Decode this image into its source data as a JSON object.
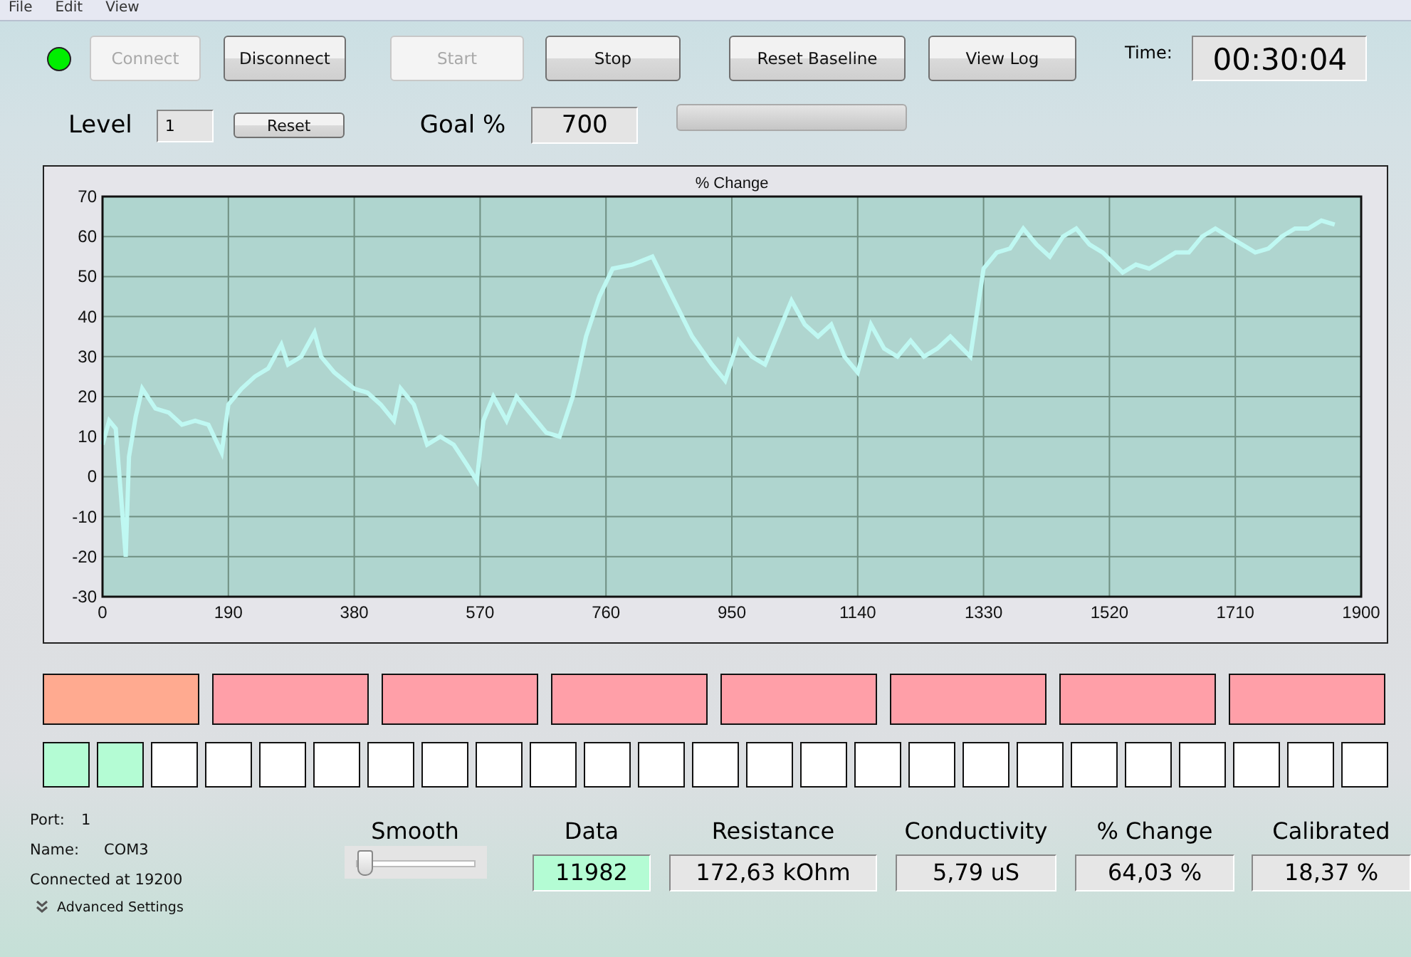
{
  "menu": [
    "File",
    "Edit",
    "View"
  ],
  "toolbar": {
    "connected": true,
    "buttons": [
      {
        "label": "Connect",
        "disabled": true
      },
      {
        "label": "Disconnect",
        "disabled": false
      },
      {
        "label": "Start",
        "disabled": true
      },
      {
        "label": "Stop",
        "disabled": false
      },
      {
        "label": "Reset Baseline",
        "disabled": false
      },
      {
        "label": "View Log",
        "disabled": false
      }
    ],
    "time_label": "Time:",
    "time": "00:30:04"
  },
  "level_row": {
    "level_label": "Level",
    "level_value": "1",
    "reset_button": "Reset",
    "goal_label": "Goal %",
    "goal_value": "700",
    "progress": {
      "level": 0
    }
  },
  "chart": {
    "chart_data": {
      "type": "line",
      "title": "% Change",
      "grid": true,
      "xlim": [
        0,
        1900
      ],
      "ylim": [
        -30,
        70
      ],
      "xticks": [
        0,
        190,
        380,
        570,
        760,
        950,
        1140,
        1330,
        1520,
        1710,
        1900
      ],
      "yticks": [
        -30,
        -20,
        -10,
        0,
        10,
        20,
        30,
        40,
        50,
        60,
        70
      ],
      "x": [
        0,
        10,
        20,
        35,
        40,
        50,
        60,
        80,
        100,
        120,
        140,
        160,
        180,
        190,
        210,
        230,
        250,
        270,
        280,
        300,
        320,
        330,
        350,
        380,
        400,
        420,
        440,
        450,
        470,
        490,
        510,
        530,
        550,
        565,
        575,
        590,
        610,
        625,
        650,
        670,
        690,
        710,
        730,
        750,
        770,
        800,
        830,
        860,
        890,
        920,
        940,
        960,
        980,
        1000,
        1020,
        1040,
        1060,
        1080,
        1100,
        1120,
        1140,
        1160,
        1180,
        1200,
        1220,
        1240,
        1260,
        1280,
        1310,
        1330,
        1350,
        1370,
        1390,
        1410,
        1430,
        1450,
        1470,
        1490,
        1510,
        1540,
        1560,
        1580,
        1600,
        1620,
        1640,
        1660,
        1680,
        1700,
        1720,
        1740,
        1760,
        1780,
        1800,
        1820,
        1840,
        1860
      ],
      "series": [
        {
          "color": "#bff8f2",
          "values": [
            8,
            14,
            12,
            -20,
            5,
            15,
            22,
            17,
            16,
            13,
            14,
            13,
            6,
            18,
            22,
            25,
            27,
            33,
            28,
            30,
            36,
            30,
            26,
            22,
            21,
            18,
            14,
            22,
            18,
            8,
            10,
            8,
            3,
            -1,
            14,
            20,
            14,
            20,
            15,
            11,
            10,
            20,
            35,
            45,
            52,
            53,
            55,
            45,
            35,
            28,
            24,
            34,
            30,
            28,
            36,
            44,
            38,
            35,
            38,
            30,
            26,
            38,
            32,
            30,
            34,
            30,
            32,
            35,
            30,
            52,
            56,
            57,
            62,
            58,
            55,
            60,
            62,
            58,
            56,
            51,
            53,
            52,
            54,
            56,
            56,
            60,
            62,
            60,
            58,
            56,
            57,
            60,
            62,
            62,
            64,
            63
          ]
        }
      ]
    }
  },
  "bars": [
    {
      "color": "#ffaa90"
    },
    {
      "color": "#ff9fa8"
    },
    {
      "color": "#ff9fa8"
    },
    {
      "color": "#ff9fa8"
    },
    {
      "color": "#ff9fa8"
    },
    {
      "color": "#ff9fa8"
    },
    {
      "color": "#ff9fa8"
    },
    {
      "color": "#ff9fa8"
    }
  ],
  "squares": [
    {
      "color": "#b4fcd4"
    },
    {
      "color": "#b4fcd4"
    },
    {
      "color": "#ffffff"
    },
    {
      "color": "#ffffff"
    },
    {
      "color": "#ffffff"
    },
    {
      "color": "#ffffff"
    },
    {
      "color": "#ffffff"
    },
    {
      "color": "#ffffff"
    },
    {
      "color": "#ffffff"
    },
    {
      "color": "#ffffff"
    },
    {
      "color": "#ffffff"
    },
    {
      "color": "#ffffff"
    },
    {
      "color": "#ffffff"
    },
    {
      "color": "#ffffff"
    },
    {
      "color": "#ffffff"
    },
    {
      "color": "#ffffff"
    },
    {
      "color": "#ffffff"
    },
    {
      "color": "#ffffff"
    },
    {
      "color": "#ffffff"
    },
    {
      "color": "#ffffff"
    },
    {
      "color": "#ffffff"
    },
    {
      "color": "#ffffff"
    },
    {
      "color": "#ffffff"
    },
    {
      "color": "#ffffff"
    },
    {
      "color": "#ffffff"
    }
  ],
  "port_info": {
    "port_label": "Port:",
    "port": "1",
    "name_label": "Name:",
    "name": "COM3",
    "status": "Connected at 19200",
    "advanced": "Advanced Settings"
  },
  "smooth": {
    "label": "Smooth",
    "level": 0.05
  },
  "readouts": [
    {
      "label": "Data",
      "value": "11982",
      "color": "#b4fcd4"
    },
    {
      "label": "Resistance",
      "value": "172,63 kOhm",
      "color": "#e6e6e6"
    },
    {
      "label": "Conductivity",
      "value": "5,79 uS",
      "color": "#e6e6e6"
    },
    {
      "label": "% Change",
      "value": "64,03 %",
      "color": "#e6e6e6"
    },
    {
      "label": "Calibrated",
      "value": "18,37 %",
      "color": "#e6e6e6"
    }
  ]
}
